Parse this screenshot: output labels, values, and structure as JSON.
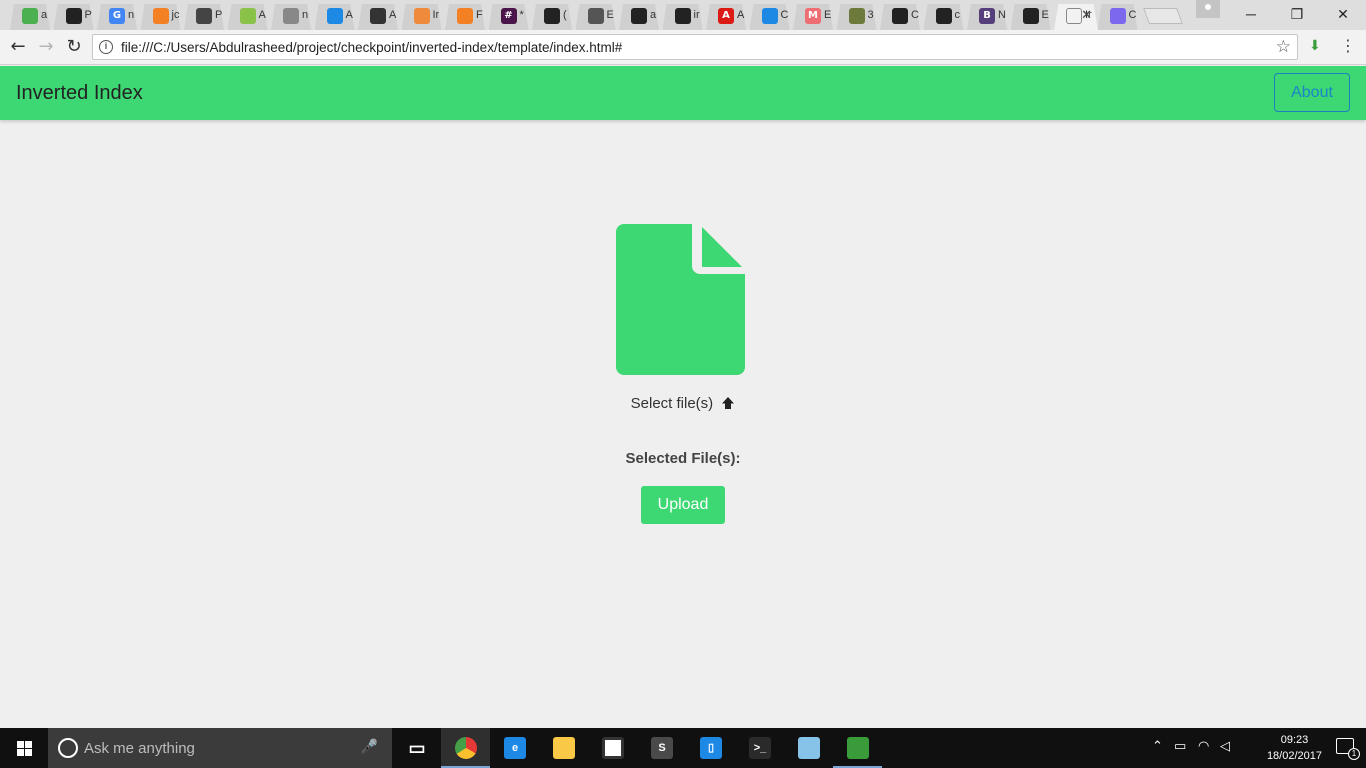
{
  "browser": {
    "tabs": [
      {
        "icon": "tab-favicon",
        "color": "#4caf50",
        "glyph": "",
        "label": "a"
      },
      {
        "icon": "github-icon",
        "color": "#222222",
        "glyph": "",
        "label": "P"
      },
      {
        "icon": "google-icon",
        "color": "#4285f4",
        "glyph": "G",
        "label": "n"
      },
      {
        "icon": "stackoverflow-icon",
        "color": "#f48024",
        "glyph": "",
        "label": "jc"
      },
      {
        "icon": "download-page-icon",
        "color": "#444444",
        "glyph": "",
        "label": "P"
      },
      {
        "icon": "tab-favicon",
        "color": "#8bc34a",
        "glyph": "",
        "label": "A"
      },
      {
        "icon": "document-icon",
        "color": "#888888",
        "glyph": "",
        "label": "n"
      },
      {
        "icon": "tab-favicon",
        "color": "#1e88e5",
        "glyph": "",
        "label": "A"
      },
      {
        "icon": "tab-favicon",
        "color": "#333333",
        "glyph": "",
        "label": "A"
      },
      {
        "icon": "tab-favicon",
        "color": "#ef8a3c",
        "glyph": "",
        "label": "Ir"
      },
      {
        "icon": "stackoverflow-icon",
        "color": "#f48024",
        "glyph": "",
        "label": "F"
      },
      {
        "icon": "slack-icon",
        "color": "#4a154b",
        "glyph": "#",
        "label": "*"
      },
      {
        "icon": "github-icon",
        "color": "#222222",
        "glyph": "",
        "label": "("
      },
      {
        "icon": "tab-favicon",
        "color": "#555555",
        "glyph": "",
        "label": "E"
      },
      {
        "icon": "github-icon",
        "color": "#222222",
        "glyph": "",
        "label": "a"
      },
      {
        "icon": "github-icon",
        "color": "#222222",
        "glyph": "",
        "label": "ir"
      },
      {
        "icon": "angular-icon",
        "color": "#dd1b16",
        "glyph": "A",
        "label": "A"
      },
      {
        "icon": "tab-favicon",
        "color": "#1e88e5",
        "glyph": "",
        "label": "C"
      },
      {
        "icon": "materialize-icon",
        "color": "#ee6e73",
        "glyph": "M",
        "label": "E"
      },
      {
        "icon": "tab-favicon",
        "color": "#6d7b3a",
        "glyph": "",
        "label": "3"
      },
      {
        "icon": "tab-favicon",
        "color": "#222222",
        "glyph": "",
        "label": "C"
      },
      {
        "icon": "github-icon",
        "color": "#222222",
        "glyph": "",
        "label": "c"
      },
      {
        "icon": "bootstrap-icon",
        "color": "#563d7c",
        "glyph": "B",
        "label": "N"
      },
      {
        "icon": "tab-favicon",
        "color": "#222222",
        "glyph": "",
        "label": "E"
      },
      {
        "icon": "tab-favicon",
        "color": "#f2f2f2",
        "glyph": "",
        "label": "Ir",
        "active": true
      },
      {
        "icon": "tab-favicon",
        "color": "#7b68ee",
        "glyph": "",
        "label": "C"
      }
    ],
    "url": "file:///C:/Users/Abdulrasheed/project/checkpoint/inverted-index/template/index.html#",
    "window_controls": {
      "minimize": "─",
      "restore": "❐",
      "close": "✕"
    },
    "nav": {
      "back": "←",
      "forward": "→",
      "reload": "↻"
    },
    "star": "☆",
    "download": "⬇",
    "menu": "⋮"
  },
  "app": {
    "title": "Inverted Index",
    "about_label": "About",
    "select_files_label": "Select file(s)",
    "selected_files_label": "Selected File(s):",
    "upload_label": "Upload",
    "accent_color": "#3dd873"
  },
  "taskbar": {
    "search_placeholder": "Ask me anything",
    "apps": [
      {
        "icon": "task-view-icon",
        "color": "#101010",
        "glyph": "▭"
      },
      {
        "icon": "chrome-icon",
        "color": "#e53935",
        "glyph": "",
        "active": true
      },
      {
        "icon": "edge-icon",
        "color": "#1e88e5",
        "glyph": "e"
      },
      {
        "icon": "file-explorer-icon",
        "color": "#f9c846",
        "glyph": ""
      },
      {
        "icon": "store-icon",
        "color": "#ffffff",
        "glyph": ""
      },
      {
        "icon": "sublime-text-icon",
        "color": "#4a4a4a",
        "glyph": "S"
      },
      {
        "icon": "app-icon",
        "color": "#1e88e5",
        "glyph": "▯"
      },
      {
        "icon": "terminal-icon",
        "color": "#2a2a2a",
        "glyph": ">_"
      },
      {
        "icon": "notepad-icon",
        "color": "#87c2e8",
        "glyph": ""
      },
      {
        "icon": "idm-icon",
        "color": "#3a9b3a",
        "glyph": ""
      }
    ],
    "time": "09:23",
    "date": "18/02/2017",
    "notifications": "1"
  }
}
